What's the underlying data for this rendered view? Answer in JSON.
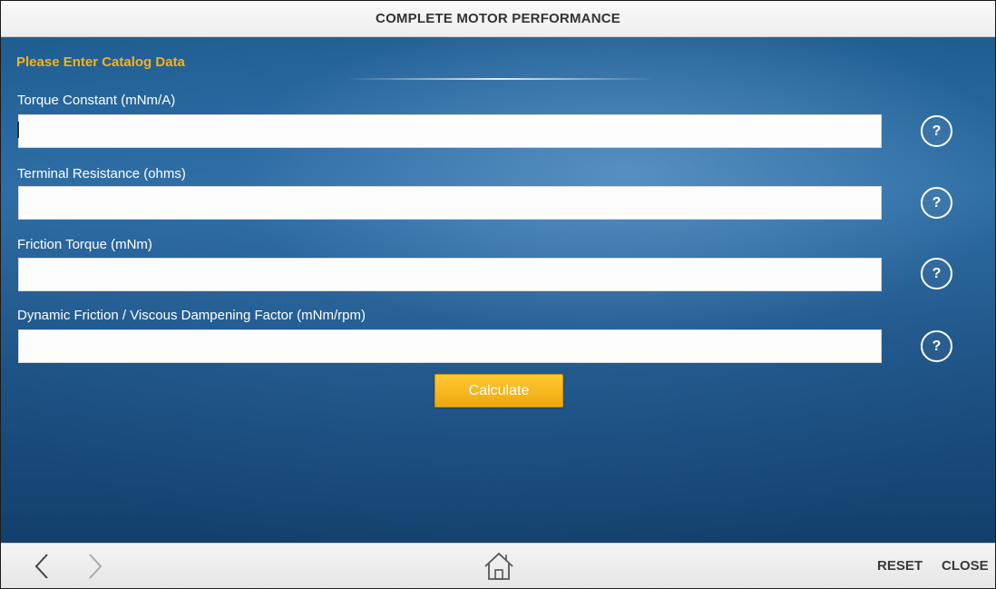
{
  "window": {
    "title": "COMPLETE MOTOR PERFORMANCE"
  },
  "form": {
    "heading": "Please Enter Catalog Data",
    "fields": [
      {
        "label": "Torque Constant (mNm/A)",
        "value": "",
        "help": "?"
      },
      {
        "label": "Terminal Resistance (ohms)",
        "value": "",
        "help": "?"
      },
      {
        "label": "Friction Torque (mNm)",
        "value": "",
        "help": "?"
      },
      {
        "label": "Dynamic Friction / Viscous Dampening Factor (mNm/rpm)",
        "value": "",
        "help": "?"
      }
    ],
    "calculate_label": "Calculate"
  },
  "bottom": {
    "back_icon": "chevron-left-icon",
    "forward_icon": "chevron-right-icon",
    "home_icon": "home-icon",
    "reset_label": "RESET",
    "close_label": "CLOSE"
  },
  "colors": {
    "accent": "#f5b21a",
    "button": "#f2ac12",
    "background": "#1e5d91"
  }
}
